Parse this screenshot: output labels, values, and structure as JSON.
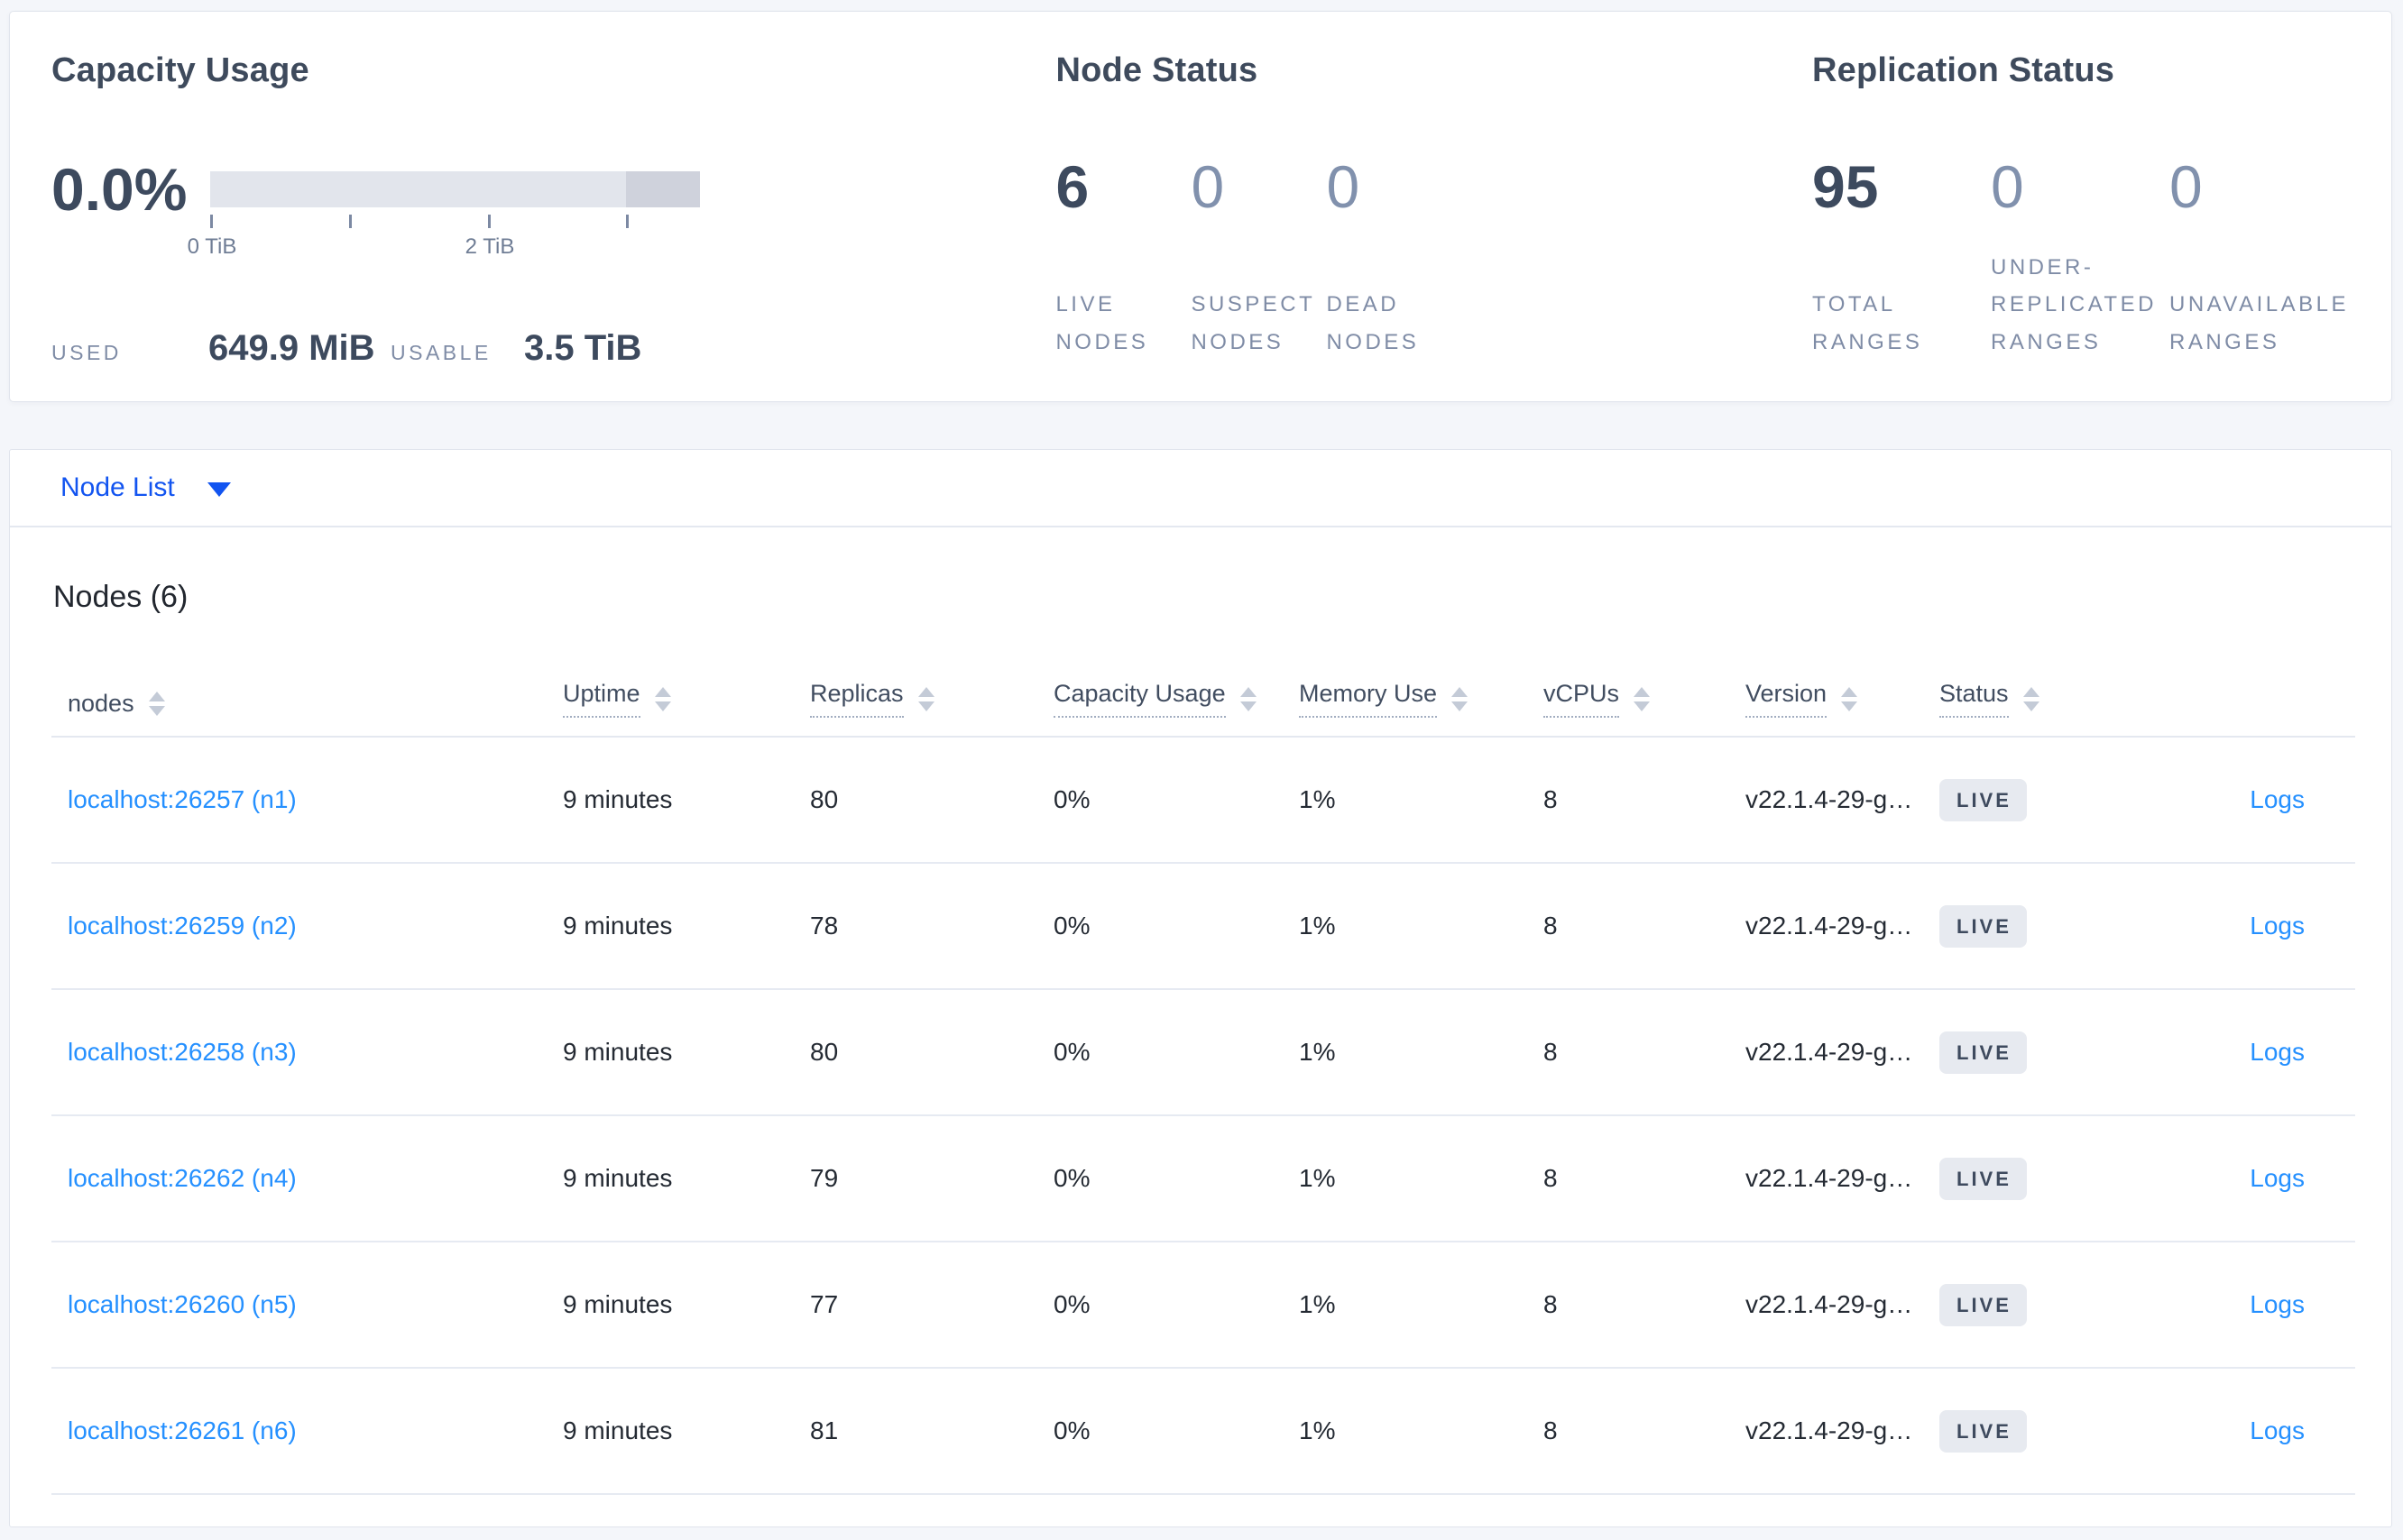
{
  "colors": {
    "page_background": "#f4f6fa",
    "card_background": "#ffffff",
    "accent_link_blue": "#2590ff",
    "selector_blue": "#1254f0",
    "dark_slate": "#3d4a5e",
    "muted_label": "#7f8ca6",
    "badge_background": "#e7eaf0",
    "gauge_light": "#e2e5ec",
    "gauge_dark": "#cfd2dc"
  },
  "icons": {
    "selector": "caret-down-icon",
    "sort": "sort-arrows-icon"
  },
  "summary": {
    "capacity": {
      "title": "Capacity Usage",
      "percent": "0.0%",
      "tick_0": "0 TiB",
      "tick_2": "2 TiB",
      "used_label": "USED",
      "used_value": "649.9 MiB",
      "usable_label": "USABLE",
      "usable_value": "3.5 TiB"
    },
    "node_status": {
      "title": "Node Status",
      "stats": [
        {
          "value": "6",
          "label": "LIVE NODES"
        },
        {
          "value": "0",
          "label": "SUSPECT NODES"
        },
        {
          "value": "0",
          "label": "DEAD NODES"
        }
      ]
    },
    "replication": {
      "title": "Replication Status",
      "stats": [
        {
          "value": "95",
          "label": "TOTAL RANGES"
        },
        {
          "value": "0",
          "label": "UNDER-REPLICATED RANGES"
        },
        {
          "value": "0",
          "label": "UNAVAILABLE RANGES"
        }
      ]
    }
  },
  "view_selector": {
    "label": "Node List"
  },
  "table": {
    "title": "Nodes (6)",
    "columns": [
      {
        "label": "nodes",
        "sortable": true
      },
      {
        "label": "Uptime",
        "sortable": true
      },
      {
        "label": "Replicas",
        "sortable": true
      },
      {
        "label": "Capacity Usage",
        "sortable": true
      },
      {
        "label": "Memory Use",
        "sortable": true
      },
      {
        "label": "vCPUs",
        "sortable": true
      },
      {
        "label": "Version",
        "sortable": true
      },
      {
        "label": "Status",
        "sortable": true
      }
    ],
    "rows": [
      {
        "address": "localhost:26257 (n1)",
        "uptime": "9 minutes",
        "replicas": "80",
        "capacity_usage": "0%",
        "memory_use": "1%",
        "vcpus": "8",
        "version": "v22.1.4-29-g…",
        "status": "LIVE",
        "logs_label": "Logs"
      },
      {
        "address": "localhost:26259 (n2)",
        "uptime": "9 minutes",
        "replicas": "78",
        "capacity_usage": "0%",
        "memory_use": "1%",
        "vcpus": "8",
        "version": "v22.1.4-29-g…",
        "status": "LIVE",
        "logs_label": "Logs"
      },
      {
        "address": "localhost:26258 (n3)",
        "uptime": "9 minutes",
        "replicas": "80",
        "capacity_usage": "0%",
        "memory_use": "1%",
        "vcpus": "8",
        "version": "v22.1.4-29-g…",
        "status": "LIVE",
        "logs_label": "Logs"
      },
      {
        "address": "localhost:26262 (n4)",
        "uptime": "9 minutes",
        "replicas": "79",
        "capacity_usage": "0%",
        "memory_use": "1%",
        "vcpus": "8",
        "version": "v22.1.4-29-g…",
        "status": "LIVE",
        "logs_label": "Logs"
      },
      {
        "address": "localhost:26260 (n5)",
        "uptime": "9 minutes",
        "replicas": "77",
        "capacity_usage": "0%",
        "memory_use": "1%",
        "vcpus": "8",
        "version": "v22.1.4-29-g…",
        "status": "LIVE",
        "logs_label": "Logs"
      },
      {
        "address": "localhost:26261 (n6)",
        "uptime": "9 minutes",
        "replicas": "81",
        "capacity_usage": "0%",
        "memory_use": "1%",
        "vcpus": "8",
        "version": "v22.1.4-29-g…",
        "status": "LIVE",
        "logs_label": "Logs"
      }
    ]
  }
}
